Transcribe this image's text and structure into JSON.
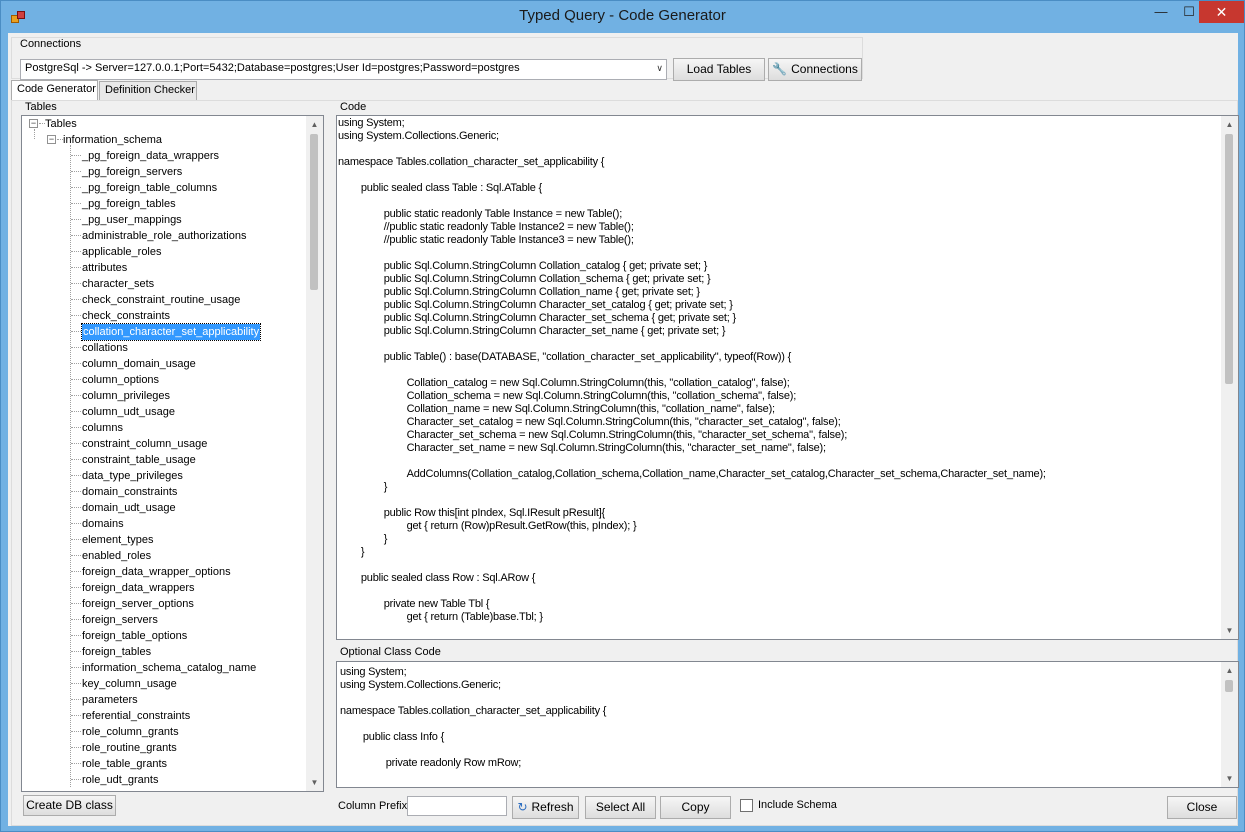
{
  "window": {
    "title": "Typed Query - Code Generator",
    "controls": {
      "minimize": "—",
      "maximize": "☐",
      "close": "✕"
    }
  },
  "connections": {
    "group_label": "Connections",
    "selected": "PostgreSql -> Server=127.0.0.1;Port=5432;Database=postgres;User Id=postgres;Password=postgres",
    "load_tables_label": "Load Tables",
    "connections_label": "Connections"
  },
  "tabs": [
    {
      "label": "Code Generator",
      "active": true
    },
    {
      "label": "Definition Checker",
      "active": false
    }
  ],
  "tables": {
    "group_label": "Tables",
    "root": "Tables",
    "schema": "information_schema",
    "selected": "collation_character_set_applicability",
    "items": [
      "_pg_foreign_data_wrappers",
      "_pg_foreign_servers",
      "_pg_foreign_table_columns",
      "_pg_foreign_tables",
      "_pg_user_mappings",
      "administrable_role_authorizations",
      "applicable_roles",
      "attributes",
      "character_sets",
      "check_constraint_routine_usage",
      "check_constraints",
      "collation_character_set_applicability",
      "collations",
      "column_domain_usage",
      "column_options",
      "column_privileges",
      "column_udt_usage",
      "columns",
      "constraint_column_usage",
      "constraint_table_usage",
      "data_type_privileges",
      "domain_constraints",
      "domain_udt_usage",
      "domains",
      "element_types",
      "enabled_roles",
      "foreign_data_wrapper_options",
      "foreign_data_wrappers",
      "foreign_server_options",
      "foreign_servers",
      "foreign_table_options",
      "foreign_tables",
      "information_schema_catalog_name",
      "key_column_usage",
      "parameters",
      "referential_constraints",
      "role_column_grants",
      "role_routine_grants",
      "role_table_grants",
      "role_udt_grants"
    ],
    "create_db_class_label": "Create DB class"
  },
  "code": {
    "group_label": "Code",
    "text": "using System;\nusing System.Collections.Generic;\n\nnamespace Tables.collation_character_set_applicability {\n\n\t\tpublic sealed class Table : Sql.ATable {\n\n\t\t\t\tpublic static readonly Table Instance = new Table();\n\t\t\t\t//public static readonly Table Instance2 = new Table();\n\t\t\t\t//public static readonly Table Instance3 = new Table();\n\n\t\t\t\tpublic Sql.Column.StringColumn Collation_catalog { get; private set; }\n\t\t\t\tpublic Sql.Column.StringColumn Collation_schema { get; private set; }\n\t\t\t\tpublic Sql.Column.StringColumn Collation_name { get; private set; }\n\t\t\t\tpublic Sql.Column.StringColumn Character_set_catalog { get; private set; }\n\t\t\t\tpublic Sql.Column.StringColumn Character_set_schema { get; private set; }\n\t\t\t\tpublic Sql.Column.StringColumn Character_set_name { get; private set; }\n\n\t\t\t\tpublic Table() : base(DATABASE, \"collation_character_set_applicability\", typeof(Row)) {\n\n\t\t\t\t\t\tCollation_catalog = new Sql.Column.StringColumn(this, \"collation_catalog\", false);\n\t\t\t\t\t\tCollation_schema = new Sql.Column.StringColumn(this, \"collation_schema\", false);\n\t\t\t\t\t\tCollation_name = new Sql.Column.StringColumn(this, \"collation_name\", false);\n\t\t\t\t\t\tCharacter_set_catalog = new Sql.Column.StringColumn(this, \"character_set_catalog\", false);\n\t\t\t\t\t\tCharacter_set_schema = new Sql.Column.StringColumn(this, \"character_set_schema\", false);\n\t\t\t\t\t\tCharacter_set_name = new Sql.Column.StringColumn(this, \"character_set_name\", false);\n\n\t\t\t\t\t\tAddColumns(Collation_catalog,Collation_schema,Collation_name,Character_set_catalog,Character_set_schema,Character_set_name);\n\t\t\t\t}\n\n\t\t\t\tpublic Row this[int pIndex, Sql.IResult pResult]{\n\t\t\t\t\t\tget { return (Row)pResult.GetRow(this, pIndex); }\n\t\t\t\t}\n\t\t}\n\n\t\tpublic sealed class Row : Sql.ARow {\n\n\t\t\t\tprivate new Table Tbl {\n\t\t\t\t\t\tget { return (Table)base.Tbl; }"
  },
  "optional_code": {
    "group_label": "Optional Class Code",
    "text": "using System;\nusing System.Collections.Generic;\n\nnamespace Tables.collation_character_set_applicability {\n\n\t\tpublic class Info {\n\n\t\t\t\tprivate readonly Row mRow;"
  },
  "bottom": {
    "column_prefix_label": "Column Prefix",
    "column_prefix_value": "",
    "refresh_label": "Refresh",
    "select_all_label": "Select All",
    "copy_label": "Copy",
    "include_schema_label": "Include Schema",
    "include_schema_checked": false,
    "close_label": "Close"
  }
}
